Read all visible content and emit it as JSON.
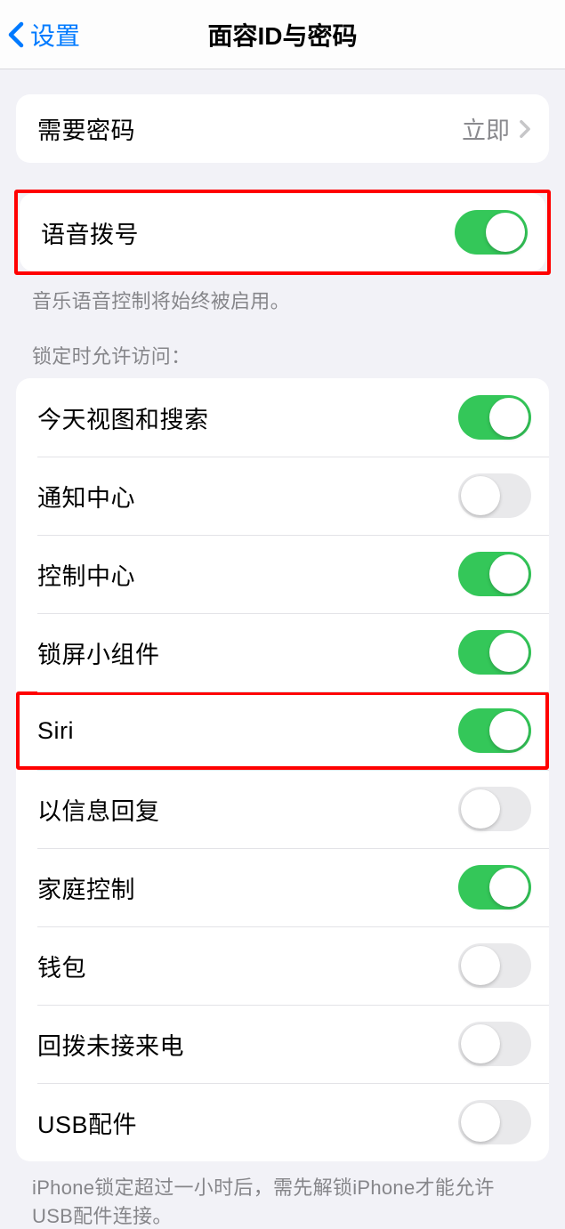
{
  "nav": {
    "back_label": "设置",
    "title": "面容ID与密码"
  },
  "passcode_group": {
    "require_passcode_label": "需要密码",
    "require_passcode_value": "立即"
  },
  "voice_dial": {
    "label": "语音拨号",
    "footer": "音乐语音控制将始终被启用。"
  },
  "lock_access": {
    "header": "锁定时允许访问：",
    "items": {
      "today_view": {
        "label": "今天视图和搜索",
        "on": true
      },
      "notification_center": {
        "label": "通知中心",
        "on": false
      },
      "control_center": {
        "label": "控制中心",
        "on": true
      },
      "lock_widgets": {
        "label": "锁屏小组件",
        "on": true
      },
      "siri": {
        "label": "Siri",
        "on": true
      },
      "reply_message": {
        "label": "以信息回复",
        "on": false
      },
      "home_control": {
        "label": "家庭控制",
        "on": true
      },
      "wallet": {
        "label": "钱包",
        "on": false
      },
      "return_calls": {
        "label": "回拨未接来电",
        "on": false
      },
      "usb_accessories": {
        "label": "USB配件",
        "on": false
      }
    },
    "footer": "iPhone锁定超过一小时后，需先解锁iPhone才能允许USB配件连接。"
  }
}
